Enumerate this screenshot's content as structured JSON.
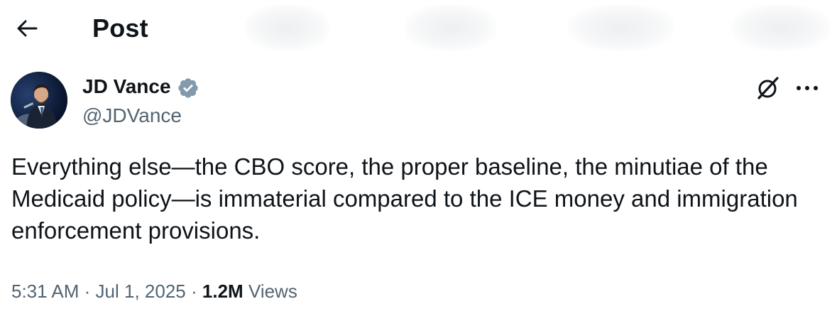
{
  "header": {
    "title": "Post",
    "back_icon": "arrow-left-icon"
  },
  "author": {
    "name": "JD Vance",
    "handle": "@JDVance",
    "verified": true,
    "badge_color": "#829aab",
    "avatar_icon": "profile-photo"
  },
  "actions": {
    "grok_icon": "grok-icon",
    "more_icon": "more-horizontal-icon"
  },
  "post": {
    "text": "Everything else—the CBO score, the proper baseline, the minutiae of the Medicaid policy—is immaterial compared to the ICE money and immigration enforcement provisions."
  },
  "meta": {
    "time": "5:31 AM",
    "separator": "·",
    "date": "Jul 1, 2025",
    "views_count": "1.2M",
    "views_label": "Views"
  },
  "colors": {
    "text_primary": "#0f1419",
    "text_secondary": "#536471",
    "background": "#ffffff"
  }
}
